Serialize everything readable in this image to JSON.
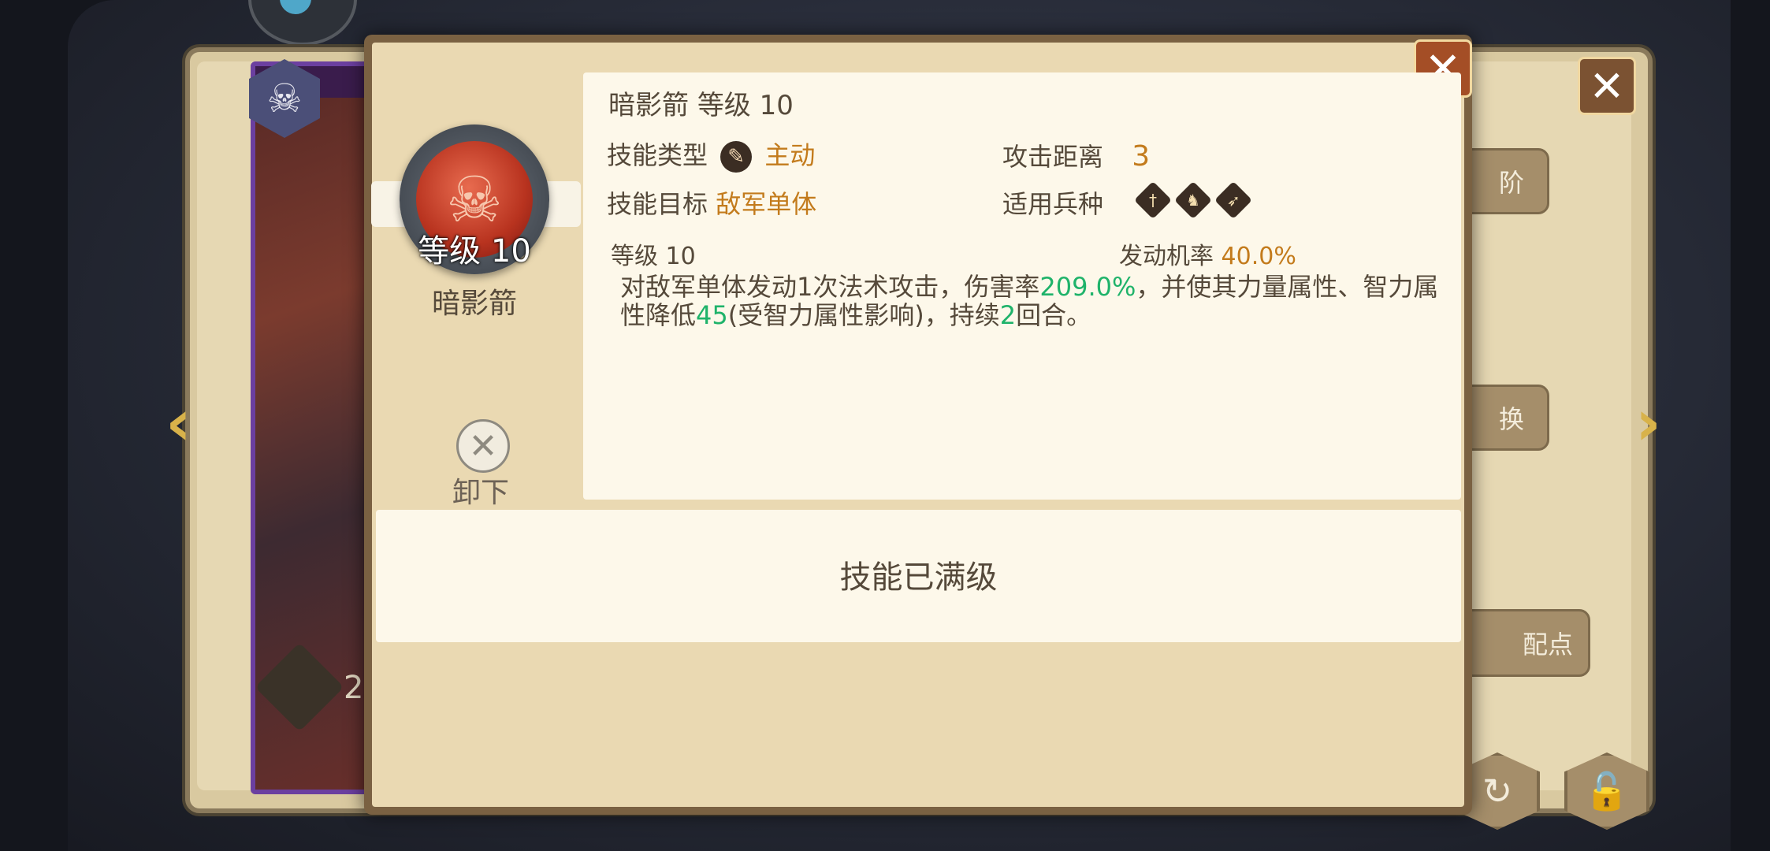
{
  "background": {
    "side_buttons": {
      "advance": "阶",
      "swap": "换",
      "allocate": "配点"
    },
    "hero_unit_count": "2",
    "icons": {
      "skull": "skull-icon",
      "cavalry": "horse-icon",
      "left_arrow": "chevron-left-icon",
      "right_arrow": "chevron-right-icon",
      "refresh": "refresh-icon",
      "lock": "lock-icon",
      "close": "close-icon"
    }
  },
  "popup": {
    "skill_icon": {
      "level_badge": "等级 10",
      "name": "暗影箭"
    },
    "unequip_label": "卸下",
    "header": {
      "name": "暗影箭",
      "level_label": "等级",
      "level_value": "10"
    },
    "skill_type": {
      "label": "技能类型",
      "value": "主动"
    },
    "attack_range": {
      "label": "攻击距离",
      "value": "3"
    },
    "skill_target": {
      "label": "技能目标",
      "value": "敌军单体"
    },
    "applicable_units": {
      "label": "适用兵种",
      "icons": [
        "sword-icon",
        "horse-icon",
        "bow-icon"
      ]
    },
    "level_line": {
      "label": "等级",
      "value": "10"
    },
    "trigger_rate": {
      "label": "发动机率",
      "value": "40.0%"
    },
    "description": {
      "p1": "对敌军单体发动1次法术攻击，伤害率",
      "v1": "209.0%",
      "p2": "，并使其力量属性、智力属性降低",
      "v2": "45",
      "p3": "(受智力属性影响)，持续",
      "v3": "2",
      "p4": "回合。"
    },
    "max_level_text": "技能已满级"
  },
  "colors": {
    "gold": "#c37b1c",
    "green": "#1fb36a",
    "panel": "#ead9b2",
    "card": "#fdf8ea"
  }
}
